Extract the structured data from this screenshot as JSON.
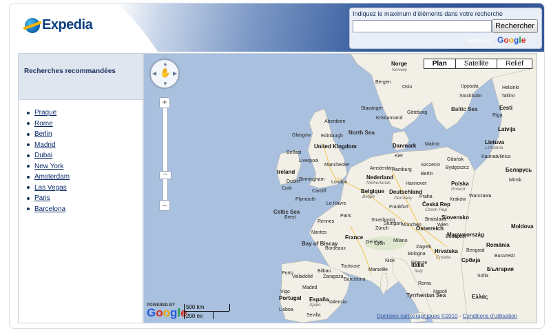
{
  "header": {
    "logo_text": "Expedia",
    "search_label": "Indiquez le maximum d'éléments dans votre recherche",
    "search_value": "",
    "search_button": "Rechercher",
    "powered_by": "fourni par",
    "google": "Google"
  },
  "sidebar": {
    "title": "Recherches recommandées",
    "items": [
      "Praque",
      "Rome",
      "Berlin",
      "Madrid",
      "Dubai",
      "New York",
      "Amsterdam",
      "Las Vegas",
      "Paris",
      "Barcelona"
    ]
  },
  "map": {
    "types": [
      "Plan",
      "Satellite",
      "Relief"
    ],
    "active_type": "Plan",
    "powered_by": "POWERED BY",
    "google": "Google",
    "scale_km": "500 km",
    "scale_mi": "200 mi",
    "attribution": "Données cartographiques ©2010",
    "terms": "Conditions d'utilisation",
    "countries": [
      "Norge",
      "Norway",
      "United Kingdom",
      "Ireland",
      "Nederland",
      "Netherlands",
      "Belgique",
      "België",
      "Deutschland",
      "Germany",
      "Polska",
      "Poland",
      "Česká Rep",
      "Czech Rep",
      "Slovensko",
      "Österreich",
      "France",
      "Italia",
      "Italy",
      "Hrvatska",
      "Croatia",
      "Magyarország",
      "România",
      "Србија",
      "България",
      "Portugal",
      "España",
      "Spain",
      "Danmark",
      "Eesti",
      "Latvija",
      "Lietuva",
      "Lithuania",
      "Беларусь",
      "Moldova",
      "Ελλάς"
    ],
    "seas": [
      "North Sea",
      "Baltic Sea",
      "Celtic Sea",
      "Bay of Biscay",
      "Tyrrhenian Sea"
    ],
    "cities": [
      "Bergen",
      "Oslo",
      "Uppsala",
      "Stockholm",
      "Göteborg",
      "Helsinki",
      "Tallinn",
      "Riga",
      "Glasgow",
      "Edinburgh",
      "Belfast",
      "Dublin",
      "Liverpool",
      "Manchester",
      "Birmingham",
      "London",
      "Cardiff",
      "Plymouth",
      "Cork",
      "Amsterdam",
      "Hamburg",
      "Berlin",
      "Hannover",
      "Frankfurt",
      "Praha",
      "Wien",
      "München",
      "Paris",
      "Nantes",
      "Lyon",
      "Bordeaux",
      "Toulouse",
      "Marseille",
      "Milano",
      "Roma",
      "Napoli",
      "Madrid",
      "Barcelona",
      "Valencia",
      "Porto",
      "Lisboa",
      "Sevilla",
      "Warszawa",
      "Kraków",
      "Budapest",
      "Bratislava",
      "Zagreb",
      "Beograd",
      "Bucuresti",
      "Sofia",
      "Minsk",
      "Vilnius",
      "Kaunas",
      "Gdańsk",
      "Szczecin",
      "Bydgoszcz",
      "Malmö",
      "Zürich",
      "Genève",
      "Nice",
      "Bologna",
      "Firenze",
      "Zaragoza",
      "Valladolid",
      "Bilbao",
      "Rennes",
      "Le Havre",
      "Brest",
      "Strasbourg",
      "Stuttgart",
      "Kiel",
      "Aberdeen",
      "Kristiansand",
      "Stavanger",
      "Vigo"
    ]
  }
}
